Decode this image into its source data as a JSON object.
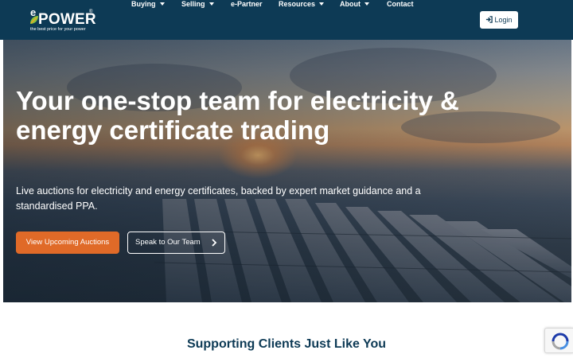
{
  "logo": {
    "prefix": "e",
    "word": "POWER",
    "registered": "®",
    "tagline": "the best price for your power"
  },
  "nav": {
    "items": [
      {
        "label": "Buying",
        "dropdown": true
      },
      {
        "label": "Selling",
        "dropdown": true
      },
      {
        "label": "e-Partner",
        "dropdown": false
      },
      {
        "label": "Resources",
        "dropdown": true
      },
      {
        "label": "About",
        "dropdown": true
      },
      {
        "label": "Contact",
        "dropdown": false
      }
    ],
    "login_label": "Login",
    "login_icon": "sign-in-icon"
  },
  "hero": {
    "headline": "Your one-stop team for electricity & energy certificate trading",
    "subtext": "Live auctions for electricity and energy certificates, backed by expert market guidance and a standardised PPA.",
    "primary_cta": "View Upcoming Auctions",
    "secondary_cta": "Speak to Our Team",
    "secondary_icon": "chevron-right-icon"
  },
  "section": {
    "title": "Supporting Clients Just Like You"
  },
  "colors": {
    "nav_bg": "#0d3a55",
    "accent": "#e06a28",
    "title": "#0d3a55"
  },
  "recaptcha_icon": "recaptcha-icon"
}
